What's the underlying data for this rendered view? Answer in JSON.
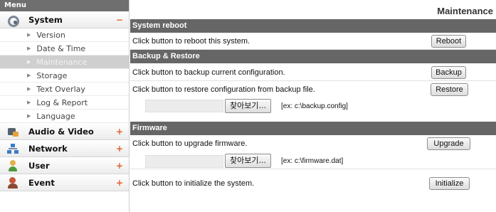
{
  "sidebar": {
    "menu_title": "Menu",
    "categories": [
      {
        "label": "System",
        "sign": "−"
      },
      {
        "label": "Audio & Video",
        "sign": "+"
      },
      {
        "label": "Network",
        "sign": "+"
      },
      {
        "label": "User",
        "sign": "+"
      },
      {
        "label": "Event",
        "sign": "+"
      }
    ],
    "system_items": [
      {
        "label": "Version"
      },
      {
        "label": "Date & Time"
      },
      {
        "label": "Maintenance"
      },
      {
        "label": "Storage"
      },
      {
        "label": "Text Overlay"
      },
      {
        "label": "Log & Report"
      },
      {
        "label": "Language"
      }
    ],
    "active_item": "Maintenance"
  },
  "main": {
    "title": "Maintenance",
    "system_reboot": {
      "header": "System reboot",
      "text": "Click button to reboot this system.",
      "button": "Reboot"
    },
    "backup_restore": {
      "header": "Backup & Restore",
      "backup_text": "Click button to backup current configuration.",
      "backup_button": "Backup",
      "restore_text": "Click button to restore configuration from backup file.",
      "restore_button": "Restore",
      "browse_button": "찾아보기...",
      "hint": "[ex: c:\\backup.config]"
    },
    "firmware": {
      "header": "Firmware",
      "text": "Click button to upgrade firmware.",
      "button": "Upgrade",
      "browse_button": "찾아보기...",
      "hint": "[ex: c:\\firmware.dat]"
    },
    "initialize": {
      "text": "Click button to initialize the system.",
      "button": "Initialize"
    }
  },
  "colors": {
    "section_header": "#666666",
    "menu_header": "#6f6f6f",
    "active_item_bg": "#cfcfcf",
    "sign_color": "#e0622a"
  }
}
